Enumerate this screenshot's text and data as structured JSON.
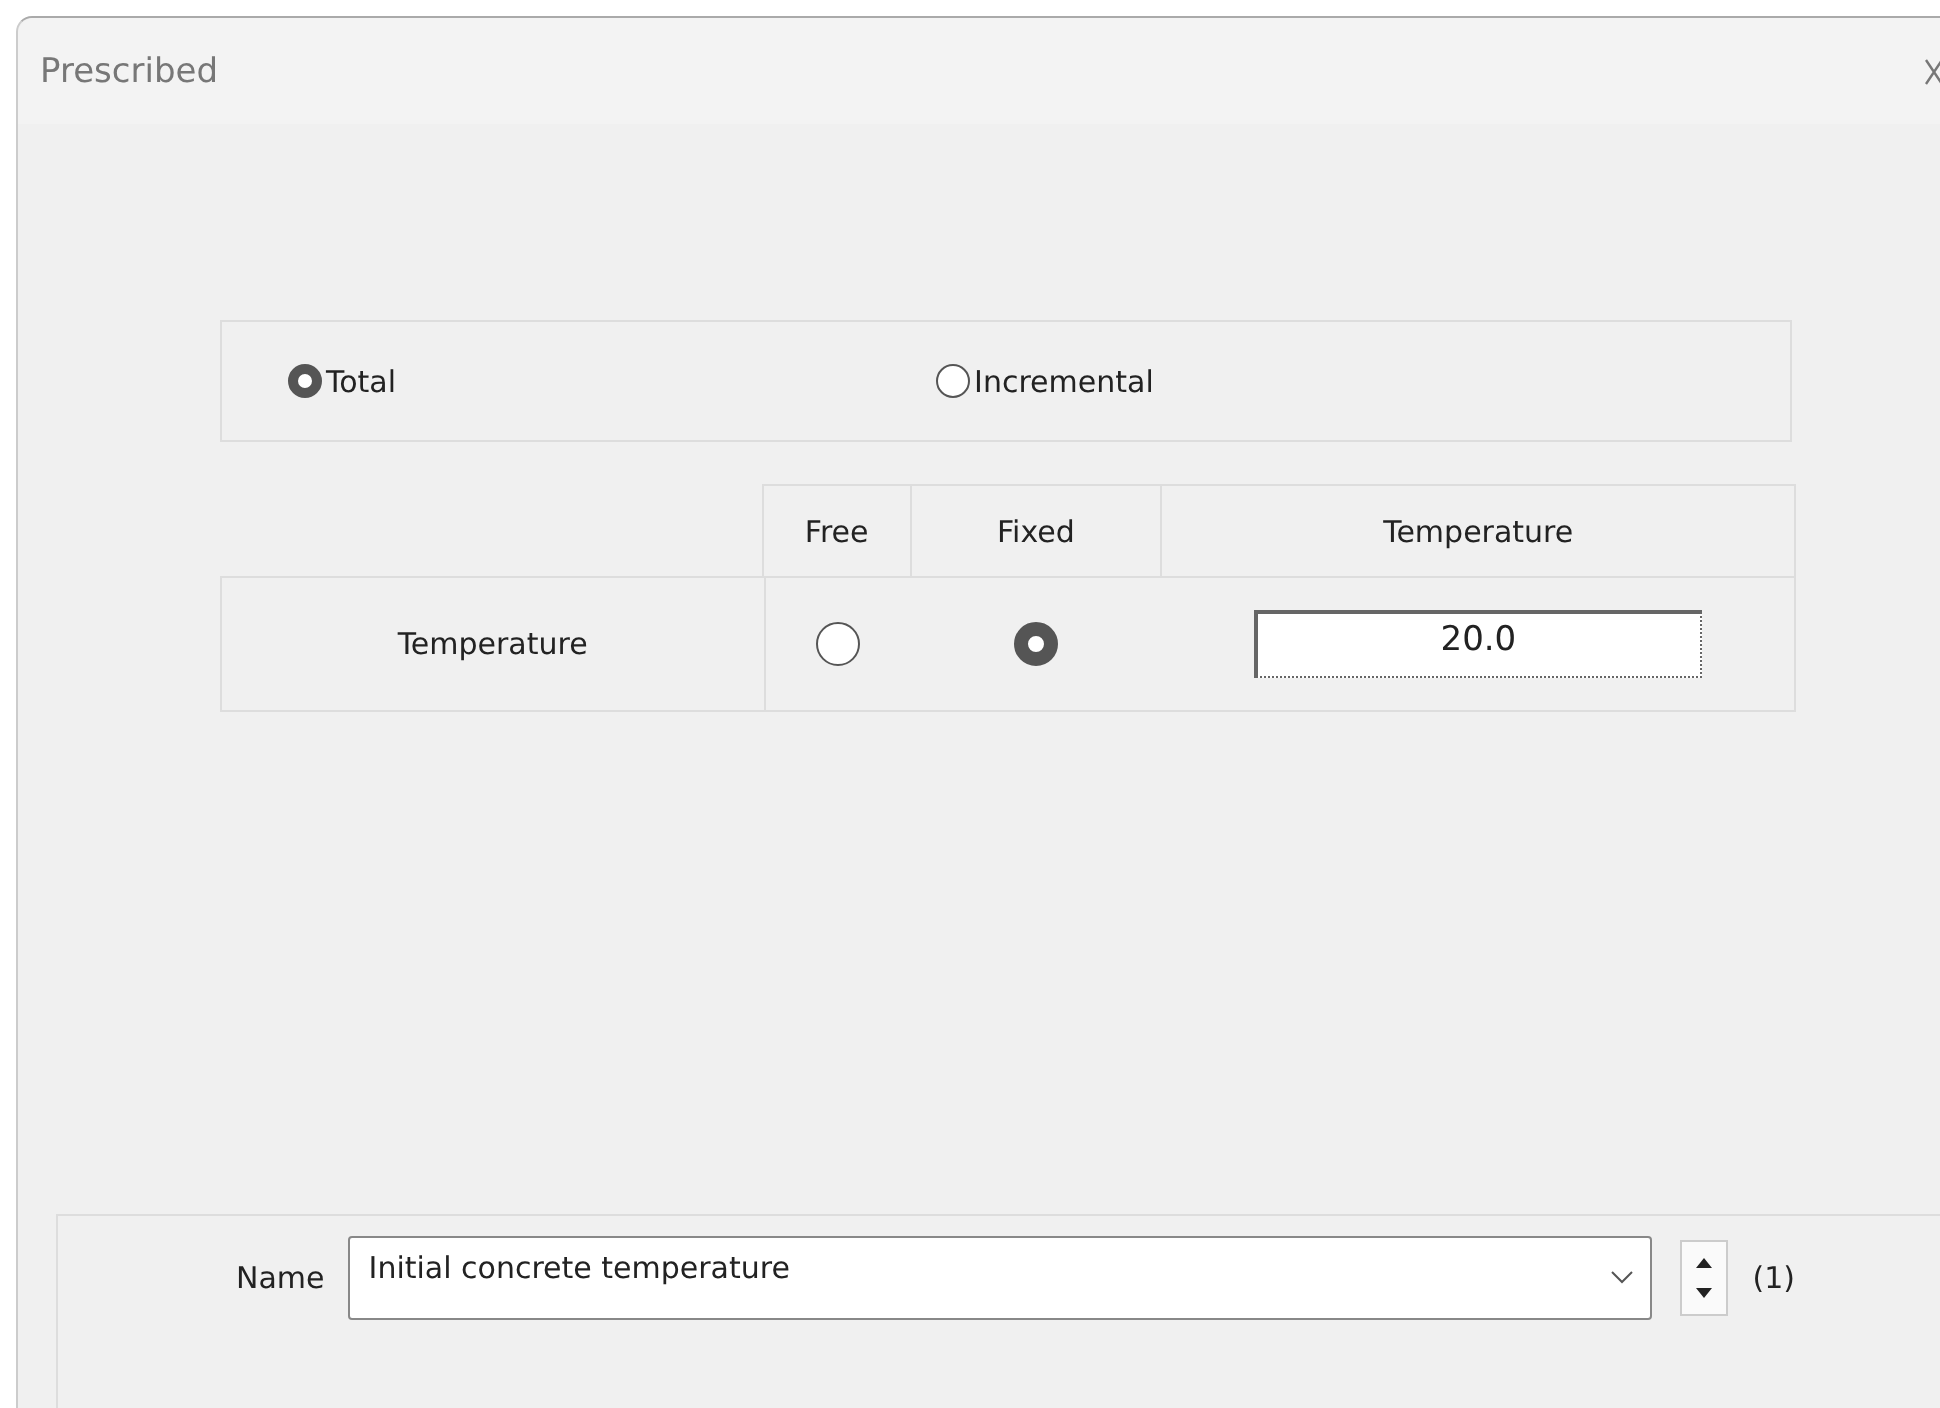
{
  "window": {
    "title": "Prescribed"
  },
  "mode_options": [
    {
      "label": "Total",
      "selected": true
    },
    {
      "label": "Incremental",
      "selected": false
    }
  ],
  "table": {
    "columns": [
      "Free",
      "Fixed",
      "Temperature"
    ],
    "rows": [
      {
        "label": "Temperature",
        "free_selected": false,
        "fixed_selected": true,
        "value": "20.0"
      }
    ]
  },
  "name_field": {
    "label": "Name",
    "value": "Initial concrete temperature",
    "counter": "(1)"
  }
}
